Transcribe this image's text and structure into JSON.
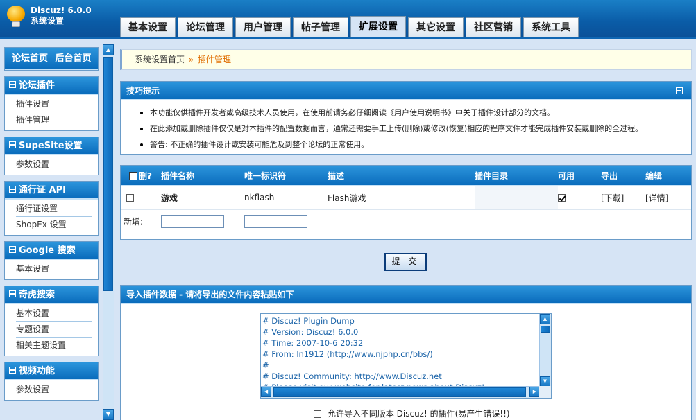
{
  "header": {
    "brand_line1": "Discuz! 6.0.0",
    "brand_line2": "系统设置",
    "tabs": [
      {
        "label": "基本设置",
        "active": false
      },
      {
        "label": "论坛管理",
        "active": false
      },
      {
        "label": "用户管理",
        "active": false
      },
      {
        "label": "帖子管理",
        "active": false
      },
      {
        "label": "扩展设置",
        "active": true
      },
      {
        "label": "其它设置",
        "active": false
      },
      {
        "label": "社区营销",
        "active": false
      },
      {
        "label": "系统工具",
        "active": false
      }
    ]
  },
  "sidebar": {
    "top_links": {
      "forum_home": "论坛首页",
      "admin_home": "后台首页"
    },
    "groups": [
      {
        "title": "论坛插件",
        "items": [
          "插件设置",
          "插件管理"
        ]
      },
      {
        "title": "SupeSite设置",
        "items": [
          "参数设置"
        ]
      },
      {
        "title": "通行证 API",
        "items": [
          "通行证设置",
          "ShopEx 设置"
        ]
      },
      {
        "title": "Google 搜索",
        "items": [
          "基本设置"
        ]
      },
      {
        "title": "奇虎搜索",
        "items": [
          "基本设置",
          "专题设置",
          "相关主题设置"
        ]
      },
      {
        "title": "视频功能",
        "items": [
          "参数设置"
        ]
      }
    ]
  },
  "breadcrumb": {
    "home": "系统设置首页",
    "sep": "»",
    "current": "插件管理"
  },
  "tips": {
    "title": "技巧提示",
    "items": [
      "本功能仅供插件开发者或高级技术人员使用，在使用前请务必仔细阅读《用户使用说明书》中关于插件设计部分的文档。",
      "在此添加或删除插件仅仅是对本插件的配置数据而言，通常还需要手工上传(删除)或修改(恢复)相应的程序文件才能完成插件安装或删除的全过程。",
      "警告: 不正确的插件设计或安装可能危及到整个论坛的正常使用。"
    ]
  },
  "plugins": {
    "headers": {
      "delete": "删?",
      "name": "插件名称",
      "identifier": "唯一标识符",
      "description": "描述",
      "directory": "插件目录",
      "available": "可用",
      "export": "导出",
      "edit": "编辑"
    },
    "rows": [
      {
        "name": "游戏",
        "identifier": "nkflash",
        "description": "Flash游戏",
        "directory": "",
        "available": true,
        "export": "[下载]",
        "edit": "[详情]"
      }
    ],
    "new_label": "新增:"
  },
  "submit_label": "提 交",
  "import": {
    "title": "导入插件数据 - 请将导出的文件内容粘贴如下",
    "dump_text": "# Discuz! Plugin Dump\n# Version: Discuz! 6.0.0\n# Time: 2007-10-6 20:32\n# From: ln1912 (http://www.njphp.cn/bbs/)\n#\n# Discuz! Community: http://www.Discuz.net\n# Please visit our website for latest news about Discuz!",
    "allow_label": "允许导入不同版本 Discuz! 的插件(易产生错误!!)"
  }
}
